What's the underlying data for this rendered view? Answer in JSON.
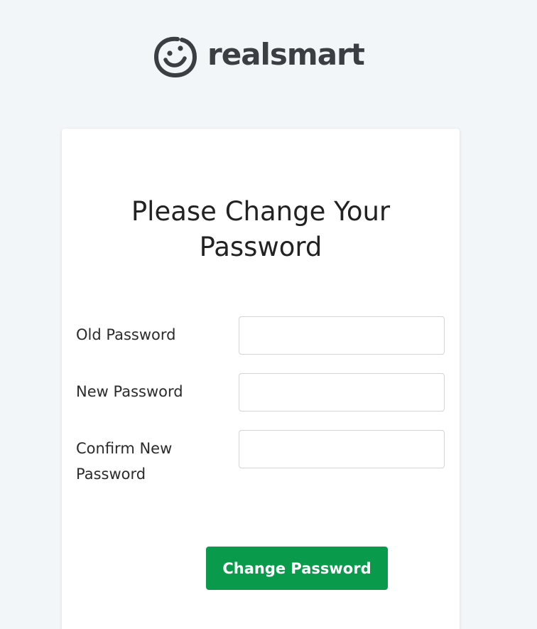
{
  "brand": {
    "logo_icon": "smiley-face-icon",
    "name": "realsmart"
  },
  "form": {
    "title": "Please Change Your Password",
    "fields": [
      {
        "label": "Old Password",
        "value": "",
        "placeholder": ""
      },
      {
        "label": "New Password",
        "value": "",
        "placeholder": ""
      },
      {
        "label": "Confirm New Password",
        "value": "",
        "placeholder": ""
      }
    ],
    "submit_label": "Change Password"
  },
  "colors": {
    "background": "#f3f6f9",
    "card": "#ffffff",
    "accent": "#0a9a4c",
    "logo": "#3b3f44"
  }
}
